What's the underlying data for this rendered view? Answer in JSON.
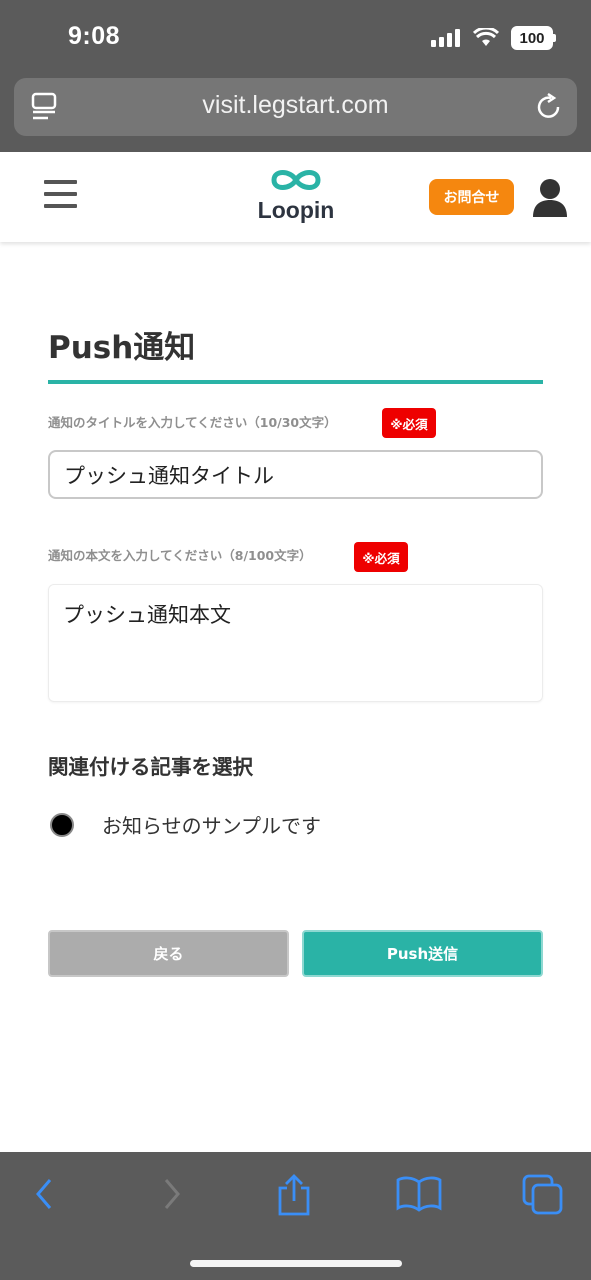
{
  "status_bar": {
    "time": "9:08",
    "battery": "100"
  },
  "browser": {
    "url": "visit.legstart.com"
  },
  "header": {
    "logo_text": "Loopin",
    "contact_label": "お問合せ"
  },
  "main": {
    "title": "Push通知",
    "title_field": {
      "label": "通知のタイトルを入力してください（10/30文字）",
      "required": "※必須",
      "value": "プッシュ通知タイトル"
    },
    "body_field": {
      "label": "通知の本文を入力してください（8/100文字）",
      "required": "※必須",
      "value": "プッシュ通知本文"
    },
    "article_section": {
      "heading": "関連付ける記事を選択",
      "option_label": "お知らせのサンプルです"
    },
    "buttons": {
      "back": "戻る",
      "push": "Push送信"
    }
  },
  "colors": {
    "accent": "#2ab3a6",
    "contact": "#f5870f",
    "required": "#ee0000",
    "chrome": "#5b5b5b",
    "toolbar_icons": "#3a8ef6"
  }
}
